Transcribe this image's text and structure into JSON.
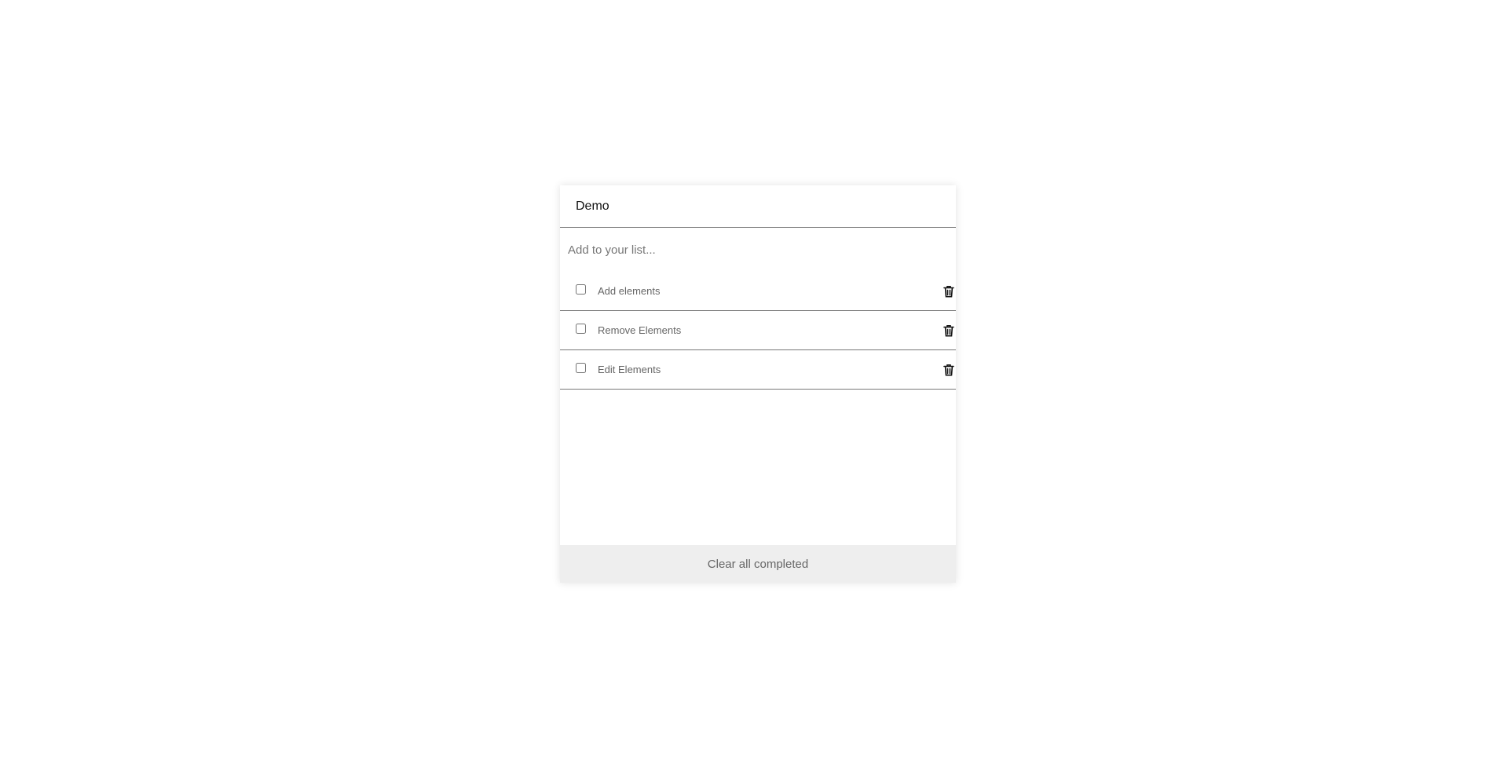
{
  "title": "Demo",
  "input": {
    "placeholder": "Add to your list..."
  },
  "items": [
    {
      "label": "Add elements",
      "checked": false
    },
    {
      "label": "Remove Elements",
      "checked": false
    },
    {
      "label": "Edit Elements",
      "checked": false
    }
  ],
  "footer": {
    "clear_label": "Clear all completed"
  },
  "icons": {
    "delete": "trash-icon"
  }
}
